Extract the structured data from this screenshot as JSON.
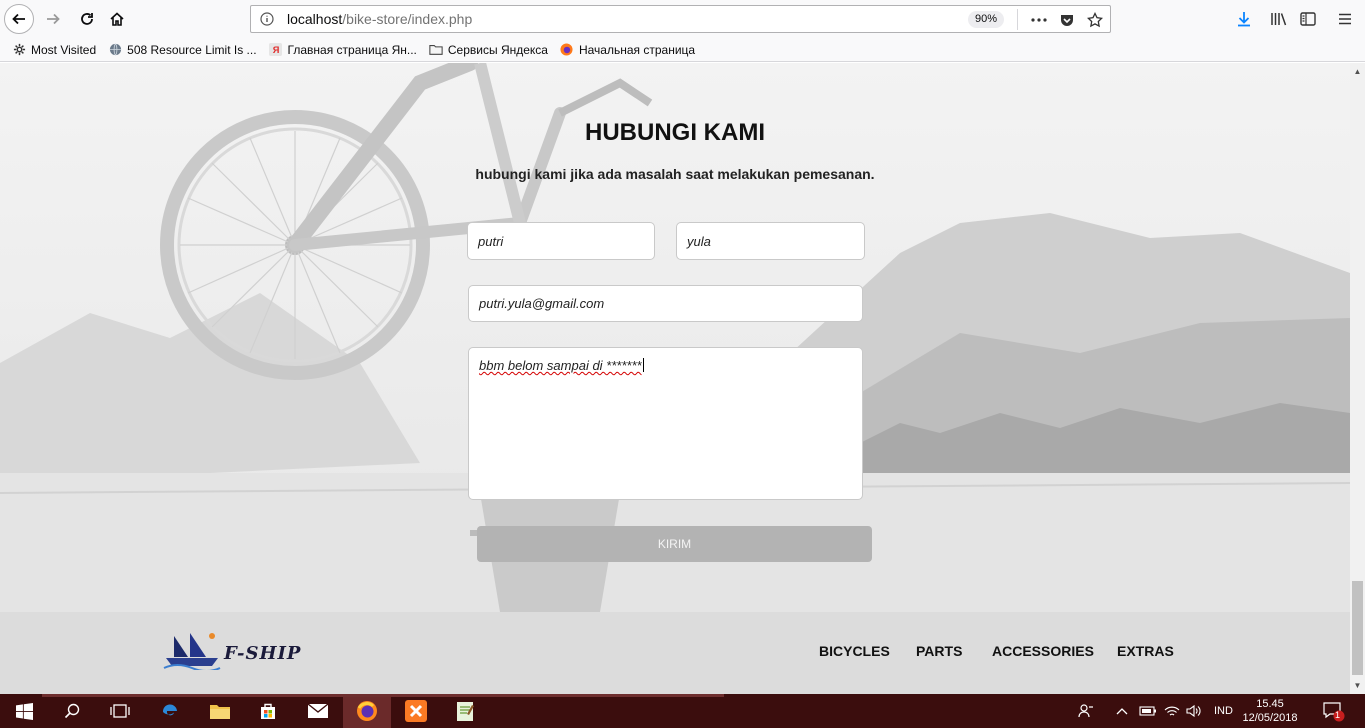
{
  "browser": {
    "url_host": "localhost",
    "url_path": "/bike-store/index.php",
    "zoom": "90%",
    "bookmarks": [
      {
        "label": "Most Visited",
        "icon": "gear-icon"
      },
      {
        "label": "508 Resource Limit Is ...",
        "icon": "globe-icon"
      },
      {
        "label": "Главная страница Ян...",
        "icon": "yandex-icon"
      },
      {
        "label": "Сервисы Яндекса",
        "icon": "folder-icon"
      },
      {
        "label": "Начальная страница",
        "icon": "firefox-icon"
      }
    ]
  },
  "contact": {
    "title": "HUBUNGI KAMI",
    "subtitle": "hubungi kami jika ada masalah saat melakukan pemesanan.",
    "first_name": "putri",
    "last_name": "yula",
    "email": "putri.yula@gmail.com",
    "message": "bbm belom sampai di *******",
    "submit_label": "KIRIM"
  },
  "footer": {
    "logo_text": "F-SHIP",
    "nav": [
      "BICYCLES",
      "PARTS",
      "ACCESSORIES",
      "EXTRAS"
    ]
  },
  "taskbar": {
    "language": "IND",
    "time": "15.45",
    "date": "12/05/2018",
    "notification_count": "1"
  },
  "colors": {
    "accent_taskbar": "#3b0d0d",
    "footer_bg": "#dcdcdc",
    "submit_bg": "#b3b3b3"
  }
}
